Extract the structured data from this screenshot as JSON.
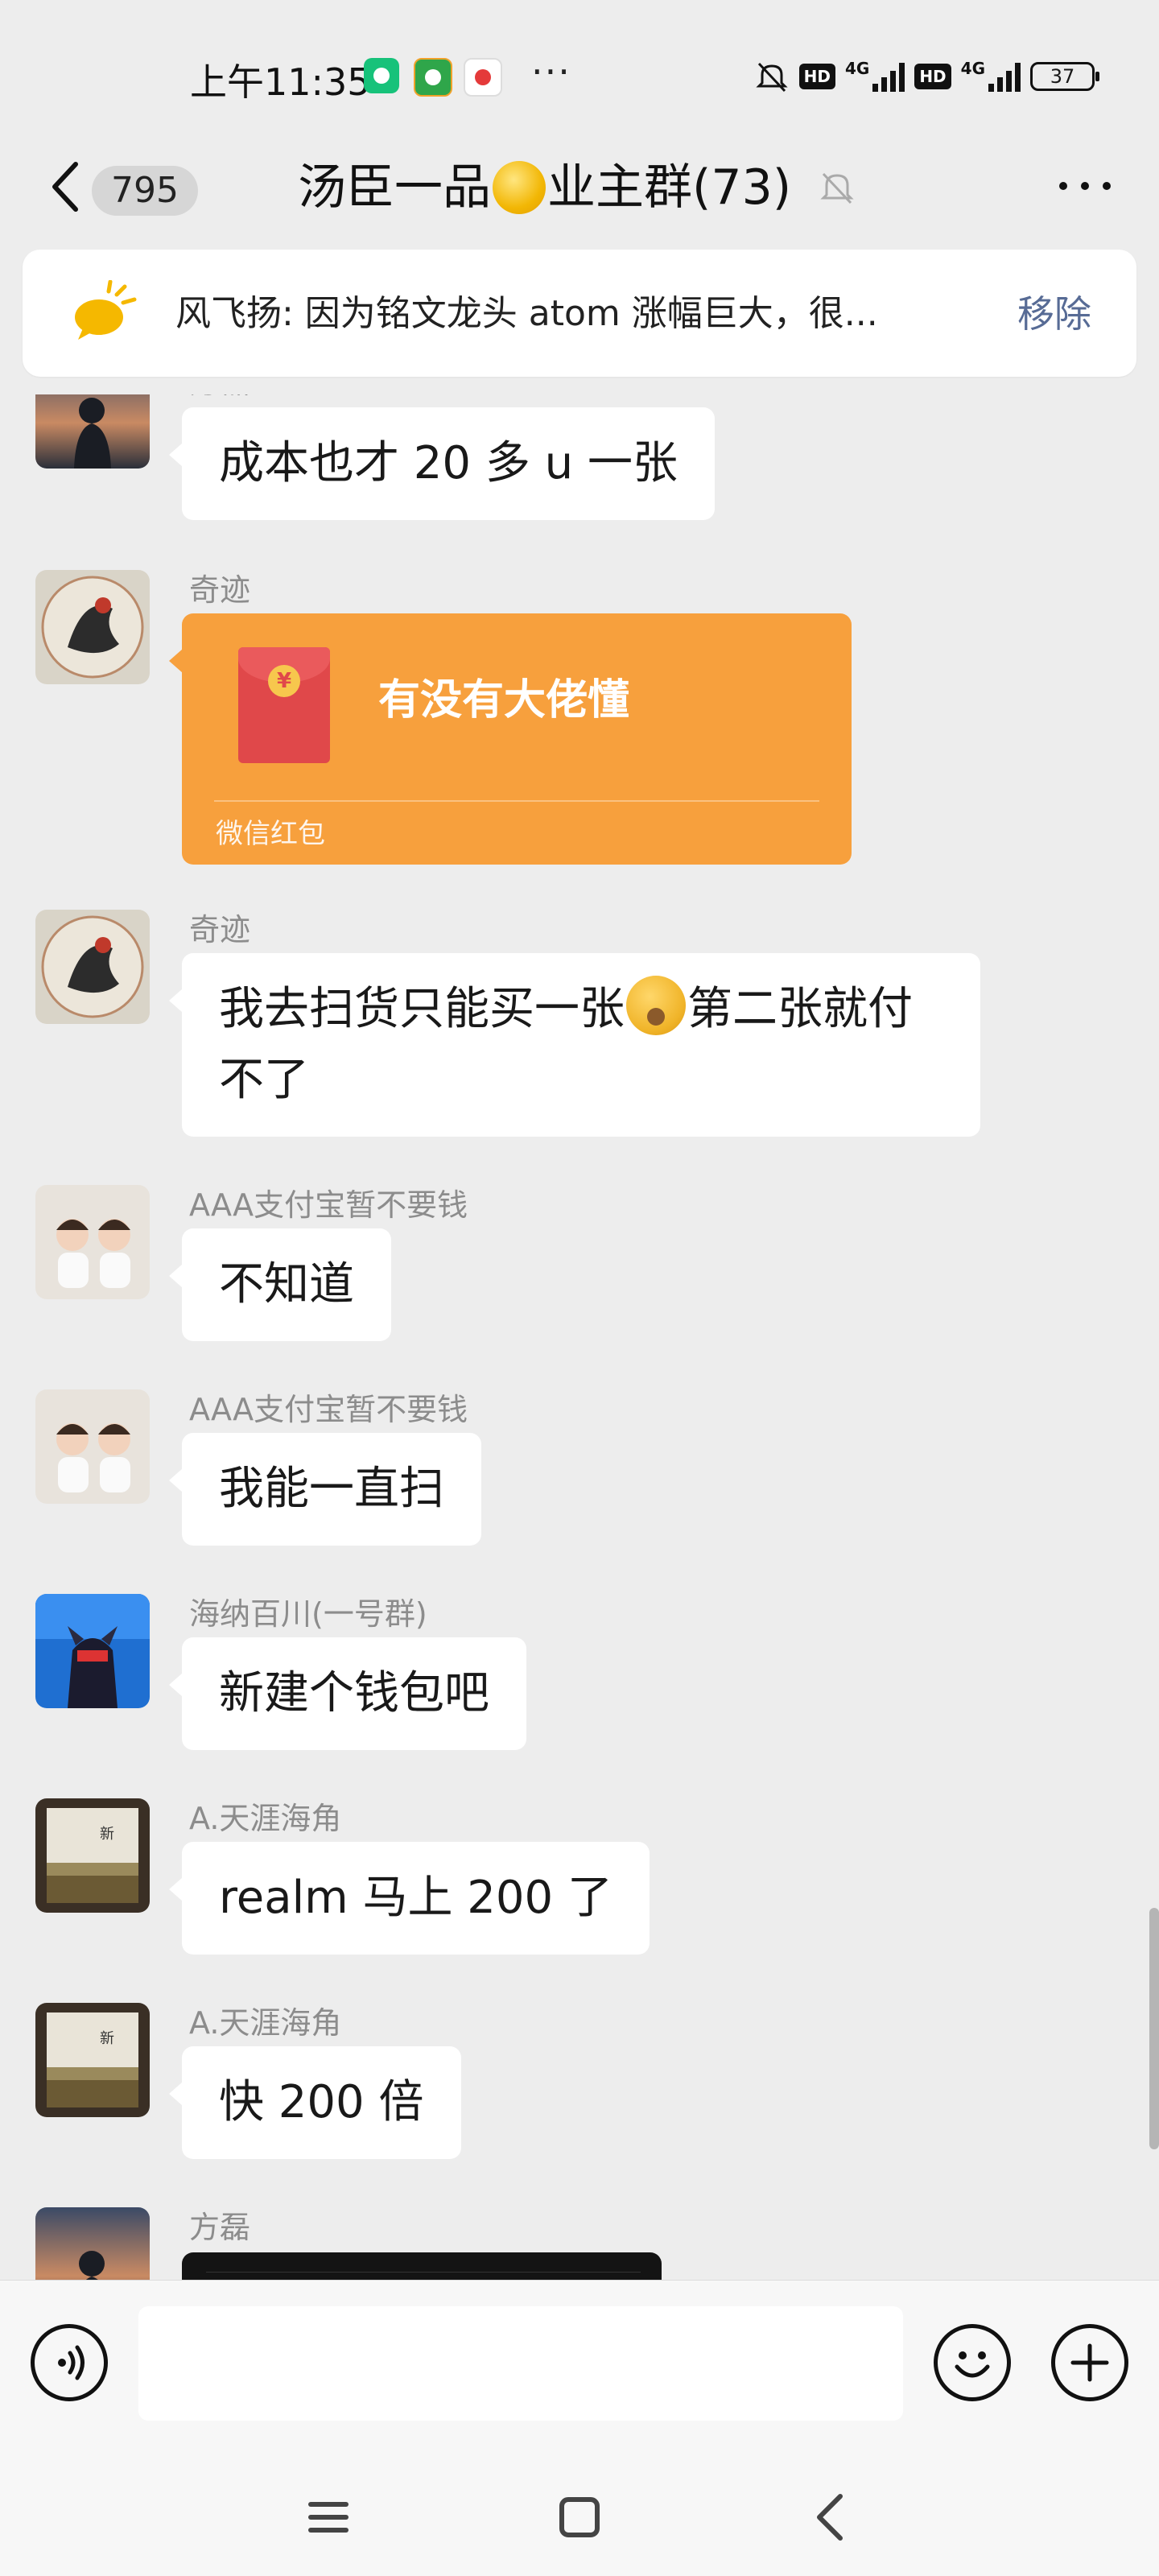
{
  "status_bar": {
    "time": "上午11:35",
    "network_1": "4G",
    "network_2": "4G",
    "hd_1": "HD",
    "hd_2": "HD",
    "battery": "37",
    "more": "···"
  },
  "header": {
    "unread_count": "795",
    "title_left": "汤臣一品",
    "title_right": "业主群(73)"
  },
  "pinned": {
    "text": "风飞扬: 因为铭文龙头 atom 涨幅巨大，很...",
    "remove_label": "移除"
  },
  "messages": [
    {
      "sender": "方磊",
      "text": "成本也才 20 多 u 一张"
    },
    {
      "sender": "奇迹",
      "redpacket_title": "有没有大佬懂",
      "redpacket_label": "微信红包"
    },
    {
      "sender": "奇迹",
      "text_before": "我去扫货只能买一张",
      "text_after": "第二张就付不了"
    },
    {
      "sender": "AAA支付宝暂不要钱",
      "text": "不知道"
    },
    {
      "sender": "AAA支付宝暂不要钱",
      "text": "我能一直扫"
    },
    {
      "sender": "海纳百川(一号群)",
      "text": "新建个钱包吧"
    },
    {
      "sender": "A.天涯海角",
      "text": "realm 马上 200 了"
    },
    {
      "sender": "A.天涯海角",
      "text": "快 200 倍"
    },
    {
      "sender": "方磊"
    }
  ],
  "input": {
    "placeholder": ""
  },
  "colors": {
    "background": "#ededed",
    "bubble": "#ffffff",
    "redpacket": "#f7a03d",
    "link": "#576b95"
  }
}
